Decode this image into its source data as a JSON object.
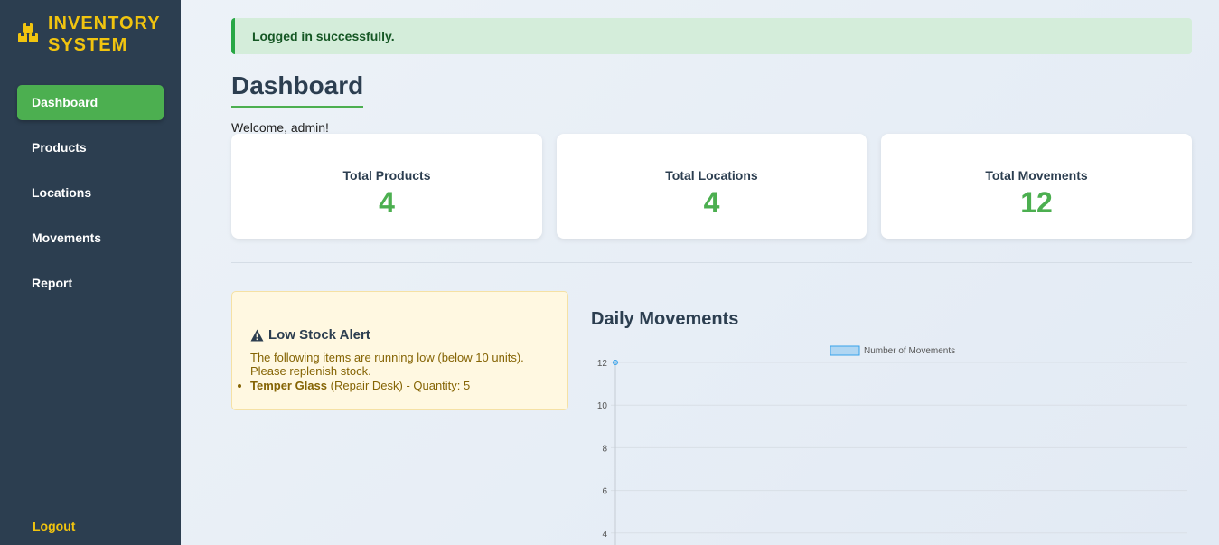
{
  "app": {
    "brand": "INVENTORY\nSYSTEM",
    "brand_icon": "boxes-icon",
    "accent_color": "#4caf50",
    "brand_color": "#f1c40f"
  },
  "sidebar": {
    "items": [
      {
        "label": "Dashboard",
        "active": true
      },
      {
        "label": "Products",
        "active": false
      },
      {
        "label": "Locations",
        "active": false
      },
      {
        "label": "Movements",
        "active": false
      },
      {
        "label": "Report",
        "active": false
      }
    ],
    "logout_label": "Logout"
  },
  "flash": {
    "message": "Logged in successfully."
  },
  "page": {
    "title": "Dashboard",
    "welcome": "Welcome, admin!"
  },
  "stats": [
    {
      "label": "Total Products",
      "value": "4"
    },
    {
      "label": "Total Locations",
      "value": "4"
    },
    {
      "label": "Total Movements",
      "value": "12"
    }
  ],
  "low_stock": {
    "icon": "warning-icon",
    "title": "Low Stock Alert",
    "text": "The following items are running low (below 10 units). Please replenish stock.",
    "items": [
      {
        "name": "Temper Glass",
        "detail": " (Repair Desk) - Quantity: 5"
      }
    ]
  },
  "daily_chart": {
    "title": "Daily Movements"
  },
  "chart_data": {
    "type": "line",
    "series": [
      {
        "name": "Number of Movements",
        "values": [
          12
        ],
        "color": "#36a2eb"
      }
    ],
    "ylim": [
      4,
      12
    ],
    "yticks": [
      "12",
      "10",
      "8",
      "6",
      "4"
    ],
    "legend": "top",
    "grid": true
  }
}
